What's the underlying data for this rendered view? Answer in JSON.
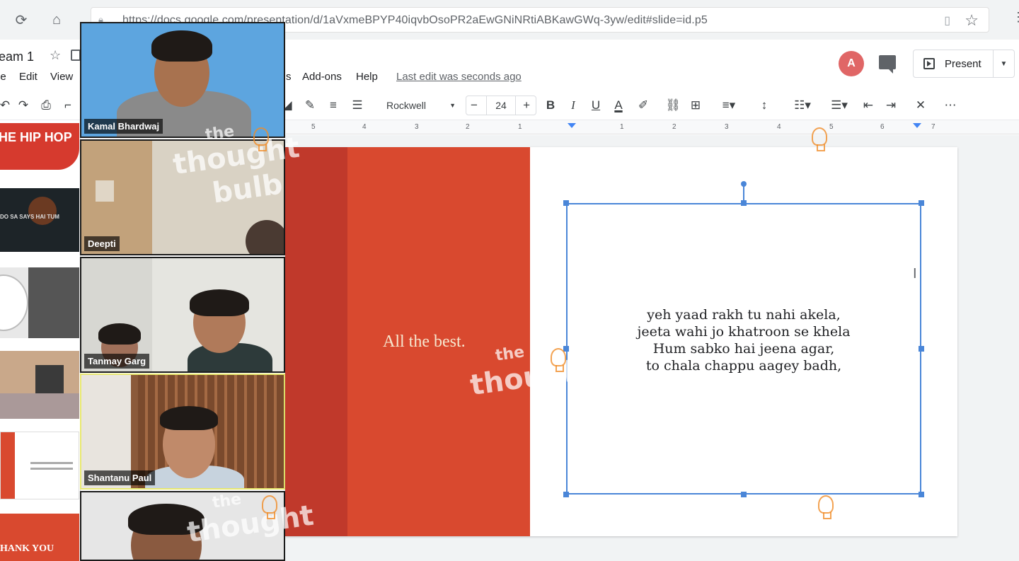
{
  "browser": {
    "url": "https://docs.google.com/presentation/d/1aVxmeBPYP40iqvbOsoPR2aEwGNiNRtiABKawGWq-3yw/edit#slide=id.p5"
  },
  "app": {
    "title": "eam 1",
    "menus": [
      "le",
      "Edit",
      "View",
      "s",
      "Add-ons",
      "Help"
    ],
    "last_edit": "Last edit was seconds ago",
    "avatar_initial": "A",
    "present_label": "Present"
  },
  "toolbar": {
    "font_name": "Rockwell",
    "font_size": "24",
    "bold": "B",
    "italic": "I",
    "underline": "U",
    "text_color": "A",
    "more": "⋯"
  },
  "ruler": {
    "ticks": [
      "5",
      "4",
      "3",
      "2",
      "1",
      "1",
      "2",
      "3",
      "4",
      "5",
      "6",
      "7"
    ]
  },
  "filmstrip": {
    "thumb1": "HE HIP HOP",
    "thumb2": "DO SA SAYS HAI TUM",
    "thumb_last": "HANK YOU"
  },
  "participants": [
    {
      "name": "Kamal Bhardwaj"
    },
    {
      "name": "Deepti"
    },
    {
      "name": "Tanmay Garg"
    },
    {
      "name": "Shantanu Paul"
    }
  ],
  "slide": {
    "heading": "All the best.",
    "lyrics": [
      "yeh yaad rakh tu nahi akela,",
      "jeeta wahi jo khatroon se khela",
      "Hum sabko hai jeena agar,",
      "to chala chappu aagey badh,"
    ]
  },
  "watermark": {
    "word1": "the",
    "word2": "thought",
    "word3": "bulb"
  },
  "colors": {
    "slide_band": "#d9492f",
    "slide_band_dark": "#c0392b",
    "selection": "#4a86d8",
    "active_speaker": "#e8e870"
  }
}
